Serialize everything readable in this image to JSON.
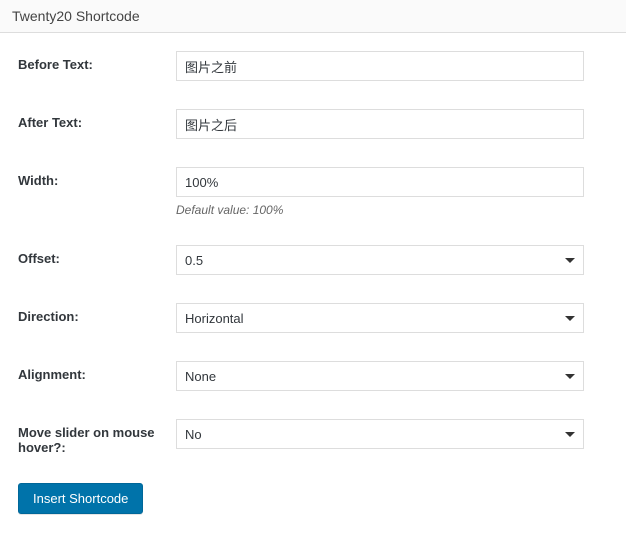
{
  "panel": {
    "title": "Twenty20 Shortcode"
  },
  "fields": {
    "before_text": {
      "label": "Before Text:",
      "value": "图片之前"
    },
    "after_text": {
      "label": "After Text:",
      "value": "图片之后"
    },
    "width": {
      "label": "Width:",
      "value": "100%",
      "help": "Default value: 100%"
    },
    "offset": {
      "label": "Offset:",
      "value": "0.5"
    },
    "direction": {
      "label": "Direction:",
      "value": "Horizontal"
    },
    "alignment": {
      "label": "Alignment:",
      "value": "None"
    },
    "hover": {
      "label": "Move slider on mouse hover?:",
      "value": "No"
    }
  },
  "button": {
    "insert": "Insert Shortcode"
  }
}
